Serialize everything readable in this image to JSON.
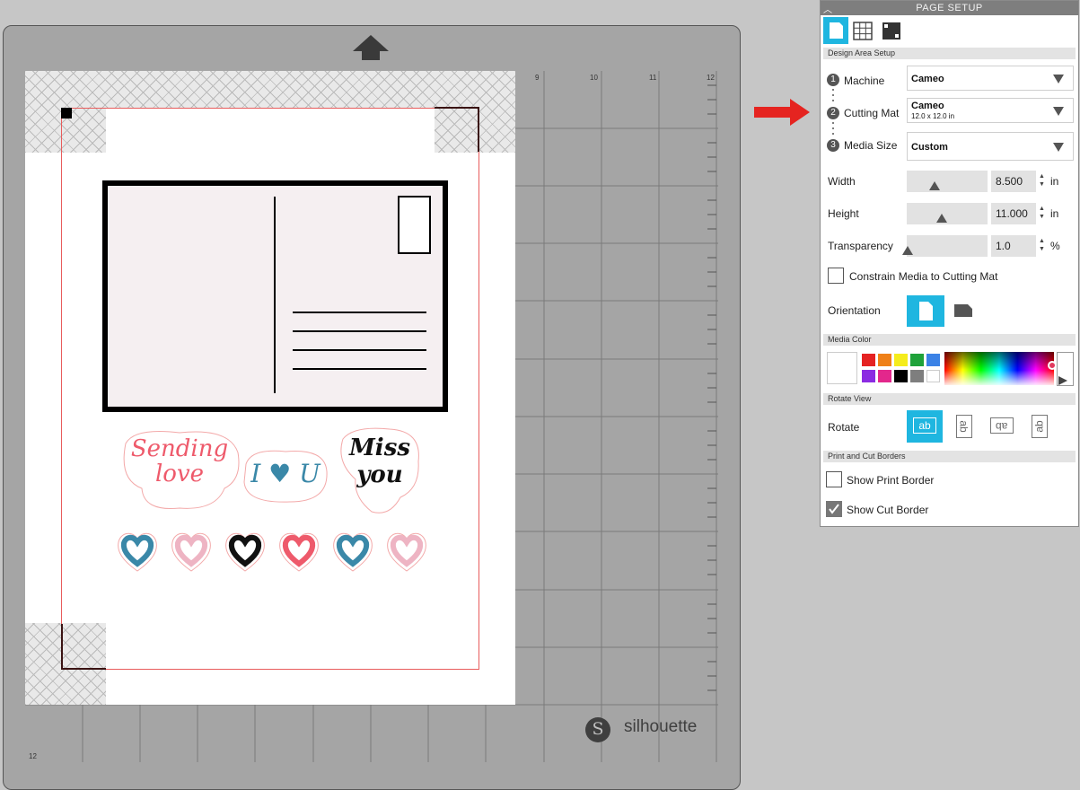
{
  "panel": {
    "title": "PAGE SETUP",
    "sections": {
      "design_area": "Design Area Setup",
      "media_color": "Media Color",
      "rotate_view": "Rotate View",
      "borders": "Print and Cut Borders"
    },
    "steps": [
      "1",
      "2",
      "3"
    ],
    "machine": {
      "label": "Machine",
      "value": "Cameo"
    },
    "cutting_mat": {
      "label": "Cutting Mat",
      "value": "Cameo",
      "sub": "12.0 x 12.0 in"
    },
    "media_size": {
      "label": "Media Size",
      "value": "Custom"
    },
    "width": {
      "label": "Width",
      "value": "8.500",
      "unit": "in"
    },
    "height": {
      "label": "Height",
      "value": "11.000",
      "unit": "in"
    },
    "transparency": {
      "label": "Transparency",
      "value": "1.0",
      "unit": "%"
    },
    "constrain": {
      "label": "Constrain Media to Cutting Mat",
      "checked": false
    },
    "orientation": {
      "label": "Orientation"
    },
    "rotate": {
      "label": "Rotate",
      "buttons": [
        "ab",
        "ab",
        "ab",
        "ab"
      ]
    },
    "show_print_border": {
      "label": "Show Print Border",
      "checked": false
    },
    "show_cut_border": {
      "label": "Show Cut Border",
      "checked": true
    },
    "swatches": [
      "#e52222",
      "#ef8018",
      "#f5ec1c",
      "#1fa23a",
      "#3b82e6",
      "#8b2be2",
      "#e3278c",
      "#000000",
      "#7e7e7e",
      "#ffffff"
    ]
  },
  "mat": {
    "ruler_top": [
      "9",
      "10",
      "11",
      "12"
    ],
    "ruler_left_bottom": "12",
    "brand": "silhouette"
  },
  "design": {
    "stickers": [
      "Sending love",
      "I ♥ U",
      "Miss you"
    ]
  },
  "colors": {
    "accent": "#1fb6e0",
    "arrow": "#e52420",
    "cut_line": "#e85c5c",
    "postcard_fill": "#f5eff1"
  }
}
